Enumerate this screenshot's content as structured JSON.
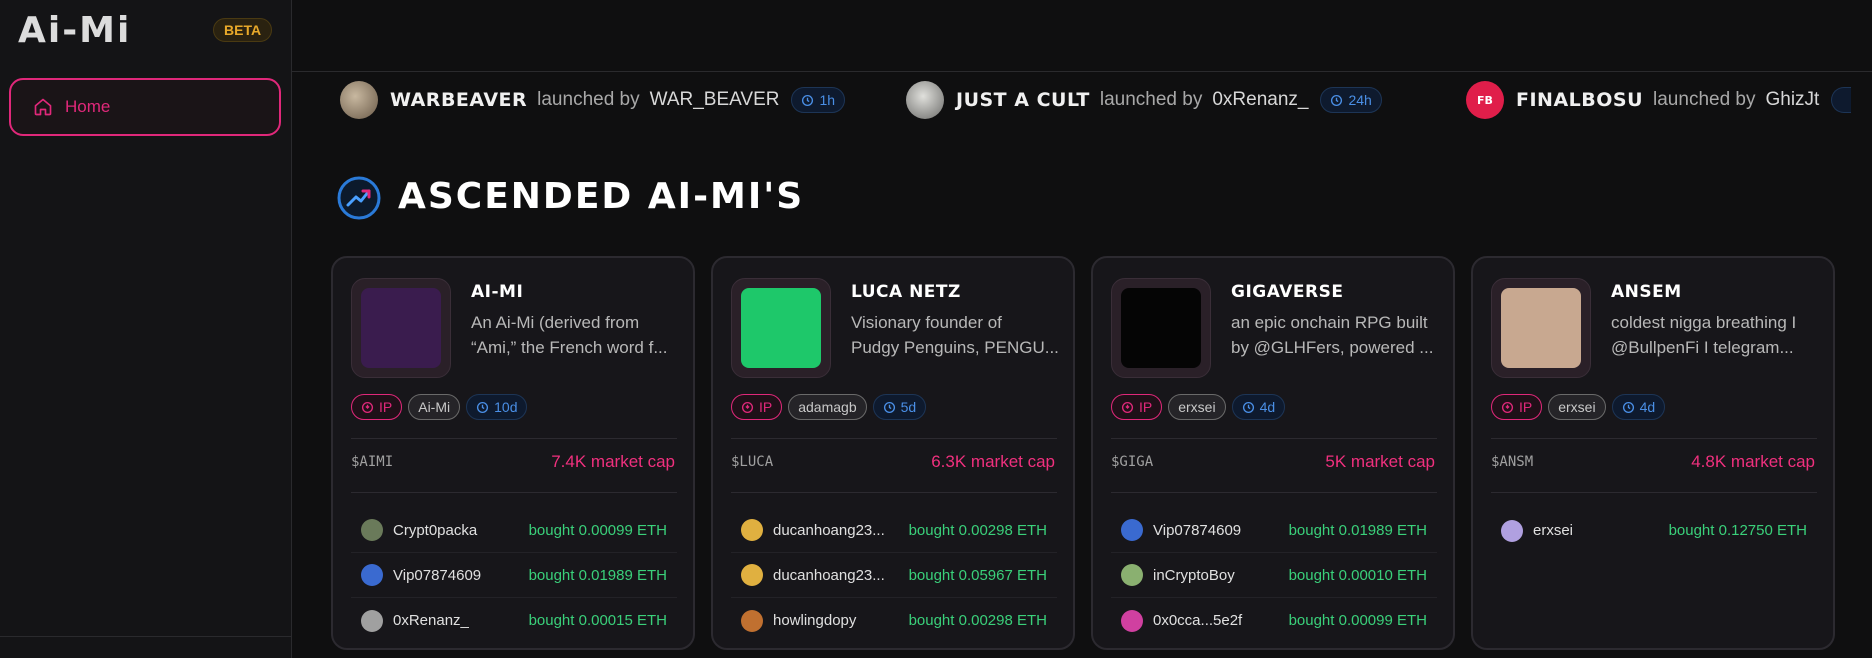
{
  "app": {
    "logo": "Ai-Mi",
    "badge": "BETA"
  },
  "sidebar": {
    "items": [
      {
        "label": "Home",
        "icon": "home-icon",
        "active": true
      }
    ]
  },
  "colors": {
    "accent": "#e0287a",
    "positive": "#3ad07a",
    "time": "#4a8fe6",
    "beta": "#e8a92a"
  },
  "ticker": [
    {
      "name": "WARBEAVER",
      "by": "launched by",
      "user": "WAR_BEAVER",
      "time": "1h",
      "avatar_color": "#8a7a66"
    },
    {
      "name": "JUST A CULT",
      "by": "launched by",
      "user": "0xRenanz_",
      "time": "24h",
      "avatar_color": "#9a9a98"
    },
    {
      "name": "FINALBOSU",
      "by": "launched by",
      "user": "GhizJt",
      "time": "",
      "avatar_color": "#e01e4a",
      "avatar_text": "FB"
    }
  ],
  "section": {
    "title": "ASCENDED AI-MI'S",
    "icon": "trending-up-icon"
  },
  "cards": [
    {
      "name": "AI-MI",
      "desc_lines": [
        "An Ai-Mi (derived from",
        "“Ami,” the French word f..."
      ],
      "tags": {
        "ip": "IP",
        "creator": "Ai-Mi",
        "age": "10d"
      },
      "symbol": "$AIMI",
      "mcap": "7.4K market cap",
      "thumb_color": "#3a1c4e",
      "trades": [
        {
          "user": "Crypt0packa",
          "amount": "bought 0.00099 ETH",
          "av": "#6a7a5a"
        },
        {
          "user": "Vip07874609",
          "amount": "bought 0.01989 ETH",
          "av": "#3a6ad0"
        },
        {
          "user": "0xRenanz_",
          "amount": "bought 0.00015 ETH",
          "av": "#a0a0a0"
        }
      ]
    },
    {
      "name": "LUCA NETZ",
      "desc_lines": [
        "Visionary founder of",
        "Pudgy Penguins, PENGU..."
      ],
      "tags": {
        "ip": "IP",
        "creator": "adamagb",
        "age": "5d"
      },
      "symbol": "$LUCA",
      "mcap": "6.3K market cap",
      "thumb_color": "#1ec86a",
      "trades": [
        {
          "user": "ducanhoang23...",
          "amount": "bought 0.00298 ETH",
          "av": "#e0b040"
        },
        {
          "user": "ducanhoang23...",
          "amount": "bought 0.05967 ETH",
          "av": "#e0b040"
        },
        {
          "user": "howlingdopy",
          "amount": "bought 0.00298 ETH",
          "av": "#c07030"
        }
      ]
    },
    {
      "name": "GIGAVERSE",
      "desc_lines": [
        "an epic onchain RPG built",
        "by @GLHFers, powered ..."
      ],
      "tags": {
        "ip": "IP",
        "creator": "erxsei",
        "age": "4d"
      },
      "symbol": "$GIGA",
      "mcap": "5K market cap",
      "thumb_color": "#050505",
      "trades": [
        {
          "user": "Vip07874609",
          "amount": "bought 0.01989 ETH",
          "av": "#3a6ad0"
        },
        {
          "user": "inCryptoBoy",
          "amount": "bought 0.00010 ETH",
          "av": "#8ab070"
        },
        {
          "user": "0x0cca...5e2f",
          "amount": "bought 0.00099 ETH",
          "av": "#d040a0"
        }
      ]
    },
    {
      "name": "ANSEM",
      "desc_lines": [
        "coldest nigga breathing I",
        "@BullpenFi I telegram..."
      ],
      "tags": {
        "ip": "IP",
        "creator": "erxsei",
        "age": "4d"
      },
      "symbol": "$ANSM",
      "mcap": "4.8K market cap",
      "thumb_color": "#c8a890",
      "trades": [
        {
          "user": "erxsei",
          "amount": "bought 0.12750 ETH",
          "av": "#b0a0e0"
        }
      ]
    }
  ]
}
